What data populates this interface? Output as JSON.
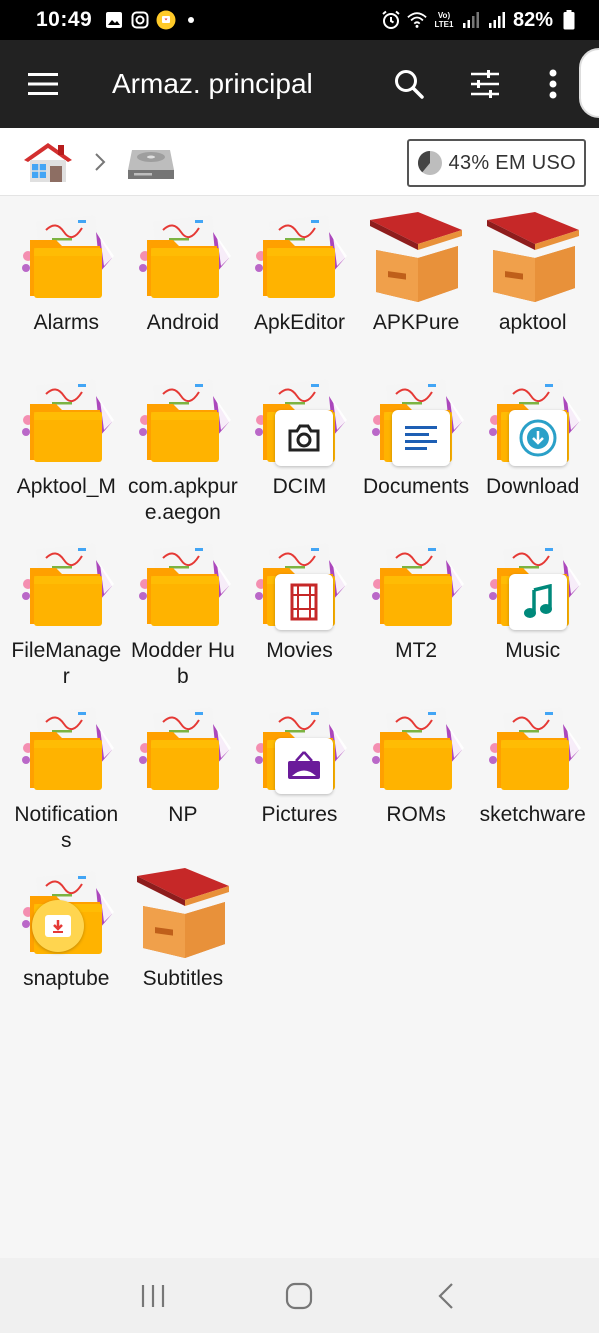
{
  "status_bar": {
    "time": "10:49",
    "battery": "82%",
    "net_label": "Vo) LTE1"
  },
  "app_bar": {
    "title": "Armaz. principal",
    "icons": [
      "menu-icon",
      "search-icon",
      "filter-icon",
      "more-vert-icon"
    ]
  },
  "breadcrumb": {
    "home_icon": "home-icon",
    "storage_icon": "hard-disk-icon",
    "usage_label": "43% EM USO"
  },
  "folders": [
    {
      "name": "Alarms",
      "icon": "folder-icon"
    },
    {
      "name": "Android",
      "icon": "folder-icon"
    },
    {
      "name": "ApkEditor",
      "icon": "folder-icon"
    },
    {
      "name": "APKPure",
      "icon": "open-box-icon"
    },
    {
      "name": "apktool",
      "icon": "open-box-icon"
    },
    {
      "name": "Apktool_M",
      "icon": "folder-icon"
    },
    {
      "name": "com.apkpure.aegon",
      "icon": "folder-icon"
    },
    {
      "name": "DCIM",
      "icon": "camera-icon"
    },
    {
      "name": "Documents",
      "icon": "document-icon"
    },
    {
      "name": "Download",
      "icon": "download-icon"
    },
    {
      "name": "FileManager",
      "icon": "folder-icon"
    },
    {
      "name": "Modder Hub",
      "icon": "folder-icon"
    },
    {
      "name": "Movies",
      "icon": "film-icon"
    },
    {
      "name": "MT2",
      "icon": "folder-icon"
    },
    {
      "name": "Music",
      "icon": "music-note-icon"
    },
    {
      "name": "Notifications",
      "icon": "folder-icon"
    },
    {
      "name": "NP",
      "icon": "folder-icon"
    },
    {
      "name": "Pictures",
      "icon": "picture-icon"
    },
    {
      "name": "ROMs",
      "icon": "folder-icon"
    },
    {
      "name": "sketchware",
      "icon": "folder-icon"
    },
    {
      "name": "snaptube",
      "icon": "snaptube-icon"
    },
    {
      "name": "Subtitles",
      "icon": "open-box-icon"
    }
  ],
  "nav_bar": {
    "icons": [
      "recent-apps-icon",
      "home-button-icon",
      "back-icon"
    ]
  },
  "colors": {
    "app_bar": "#222222",
    "folder": "#ffb300",
    "box": "#e8913a",
    "box_lid": "#d84315"
  }
}
